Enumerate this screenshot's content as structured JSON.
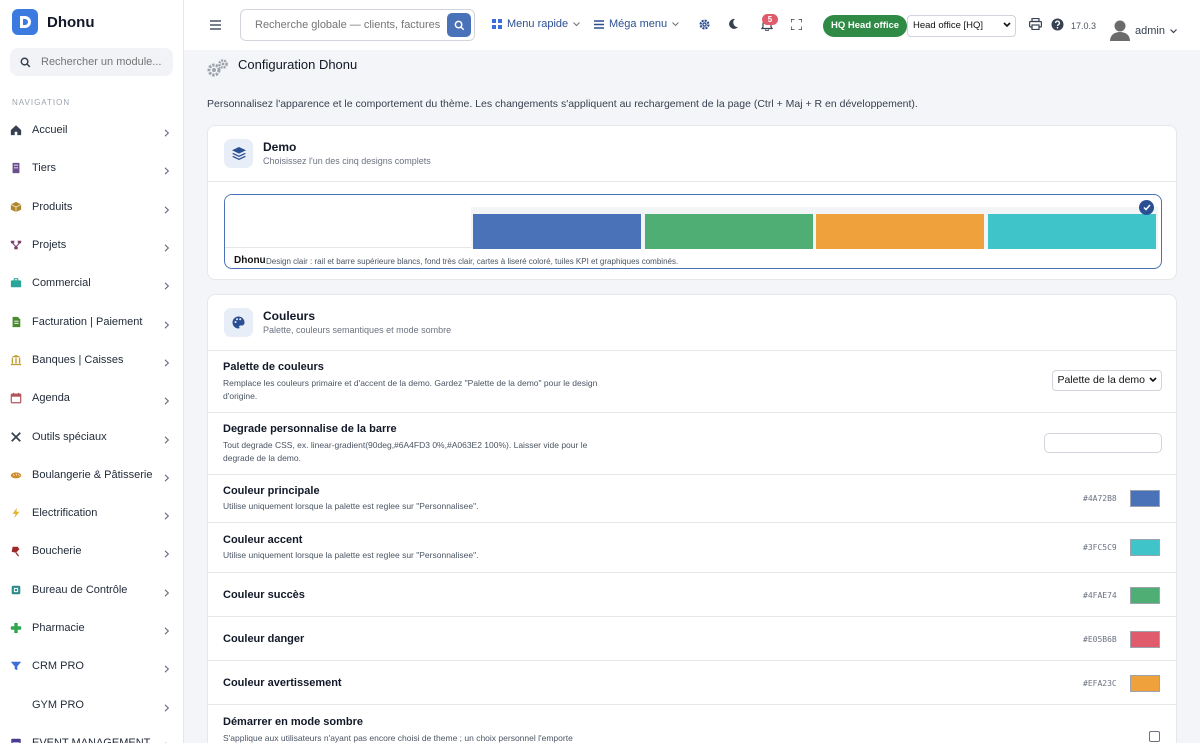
{
  "app": {
    "name": "Dhonu"
  },
  "sidebar": {
    "search_placeholder": "Rechercher un module...",
    "section_label": "NAVIGATION",
    "items": [
      {
        "label": "Accueil",
        "icon": "home-icon",
        "color": "#374151"
      },
      {
        "label": "Tiers",
        "icon": "building-icon",
        "color": "#6b4f8f"
      },
      {
        "label": "Produits",
        "icon": "box-icon",
        "color": "#b0872c"
      },
      {
        "label": "Projets",
        "icon": "network-icon",
        "color": "#7a3d6f"
      },
      {
        "label": "Commercial",
        "icon": "briefcase-icon",
        "color": "#29a59a"
      },
      {
        "label": "Facturation | Paiement",
        "icon": "invoice-icon",
        "color": "#4b8b2f"
      },
      {
        "label": "Banques | Caisses",
        "icon": "bank-icon",
        "color": "#c09a2b"
      },
      {
        "label": "Agenda",
        "icon": "calendar-icon",
        "color": "#b0565c"
      },
      {
        "label": "Outils spéciaux",
        "icon": "tools-icon",
        "color": "#374151"
      },
      {
        "label": "Boulangerie & Pâtisserie",
        "icon": "bread-icon",
        "color": "#d18a2a"
      },
      {
        "label": "Electrification",
        "icon": "bolt-icon",
        "color": "#e3b32a"
      },
      {
        "label": "Boucherie",
        "icon": "meat-icon",
        "color": "#9b2a2a"
      },
      {
        "label": "Bureau de Contrôle",
        "icon": "check-square-icon",
        "color": "#2b8a8a"
      },
      {
        "label": "Pharmacie",
        "icon": "cross-icon",
        "color": "#2fa84f"
      },
      {
        "label": "CRM PRO",
        "icon": "funnel-icon",
        "color": "#3b6ed8"
      },
      {
        "label": "GYM PRO",
        "icon": "",
        "color": "#374151"
      },
      {
        "label": "EVENT MANAGEMENT P...",
        "icon": "event-icon",
        "color": "#4b3a8f"
      }
    ]
  },
  "topbar": {
    "search_placeholder": "Recherche globale — clients, factures, p",
    "quick_menu": "Menu rapide",
    "mega_menu": "Méga menu",
    "notif_count": "5",
    "hq_badge": "HQ Head office",
    "office_select": "Head office [HQ]",
    "version": "17.0.3",
    "user": "admin"
  },
  "page": {
    "title": "Configuration Dhonu",
    "description": "Personnalisez l'apparence et le comportement du thème. Les changements s'appliquent au rechargement de la page (Ctrl + Maj + R en développement)."
  },
  "demo_card": {
    "title": "Demo",
    "subtitle": "Choisissez l'un des cinq designs complets",
    "demo_name": "Dhonu",
    "demo_desc": "Design clair : rail et barre supérieure blancs, fond très clair, cartes à liseré coloré, tuiles KPI et graphiques combinés.",
    "swatches": [
      "#4a72b8",
      "#4fae74",
      "#efa23c",
      "#3fc5c9"
    ]
  },
  "colors_card": {
    "title": "Couleurs",
    "subtitle": "Palette, couleurs semantiques et mode sombre",
    "palette": {
      "title": "Palette de couleurs",
      "desc": "Remplace les couleurs primaire et d'accent de la demo. Gardez \"Palette de la demo\" pour le design d'origine.",
      "value": "Palette de la demo"
    },
    "gradient": {
      "title": "Degrade personnalise de la barre",
      "desc": "Tout degrade CSS, ex. linear-gradient(90deg,#6A4FD3 0%,#A063E2 100%). Laisser vide pour le degrade de la demo.",
      "value": ""
    },
    "primary": {
      "title": "Couleur principale",
      "desc": "Utilise uniquement lorsque la palette est reglee sur \"Personnalisee\".",
      "hex": "#4A72B8",
      "color": "#4A72B8"
    },
    "accent": {
      "title": "Couleur accent",
      "desc": "Utilise uniquement lorsque la palette est reglee sur \"Personnalisee\".",
      "hex": "#3FC5C9",
      "color": "#3FC5C9"
    },
    "success": {
      "title": "Couleur succès",
      "hex": "#4FAE74",
      "color": "#4FAE74"
    },
    "danger": {
      "title": "Couleur danger",
      "hex": "#E05B6B",
      "color": "#E05B6B"
    },
    "warning": {
      "title": "Couleur avertissement",
      "hex": "#EFA23C",
      "color": "#EFA23C"
    },
    "dark": {
      "title": "Démarrer en mode sombre",
      "desc": "S'applique aux utilisateurs n'ayant pas encore choisi de theme ; un choix personnel l'emporte"
    }
  }
}
